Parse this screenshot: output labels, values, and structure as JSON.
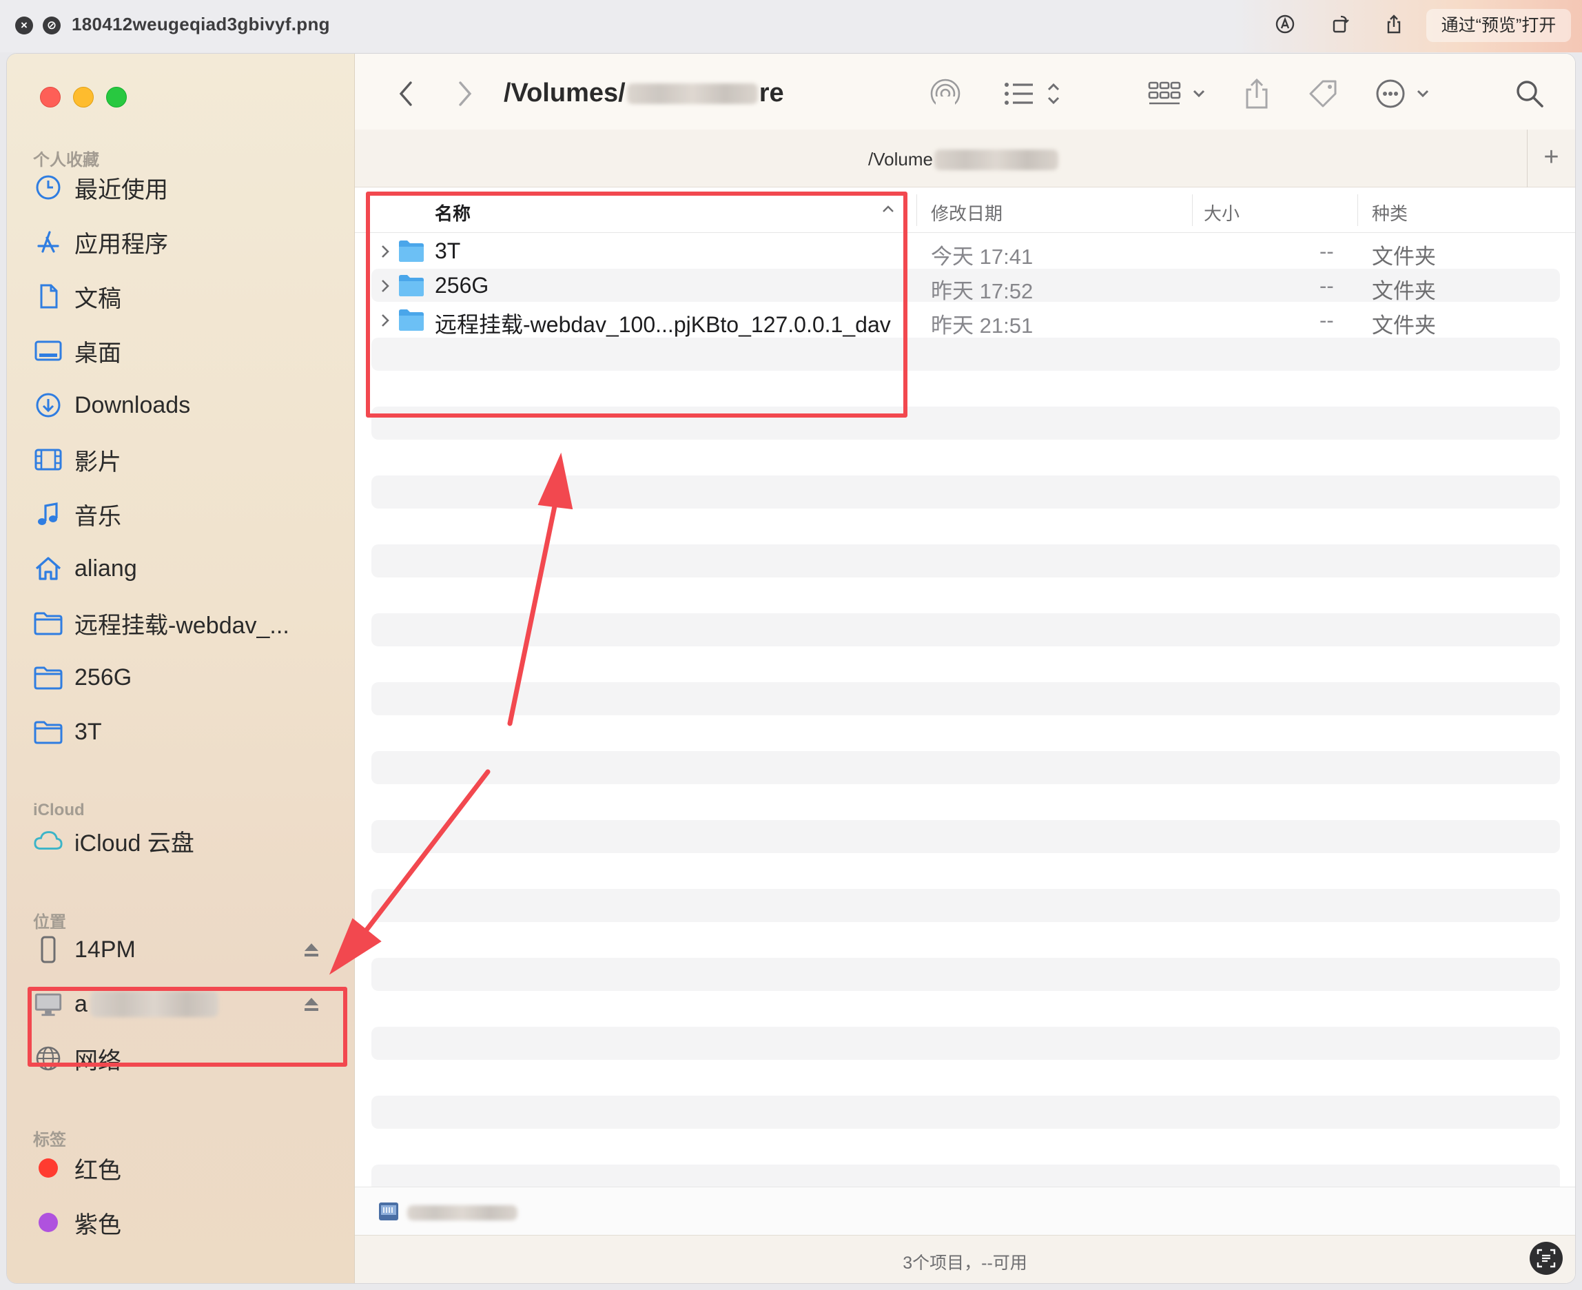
{
  "quicklook": {
    "filename": "180412weugeqiad3gbivyf.png",
    "open_with_label": "通过“预览”打开"
  },
  "sidebar": {
    "favorites_header": "个人收藏",
    "favorites": [
      {
        "label": "最近使用",
        "icon": "clock-icon"
      },
      {
        "label": "应用程序",
        "icon": "apps-icon"
      },
      {
        "label": "文稿",
        "icon": "document-icon"
      },
      {
        "label": "桌面",
        "icon": "desktop-icon"
      },
      {
        "label": "Downloads",
        "icon": "download-icon"
      },
      {
        "label": "影片",
        "icon": "film-icon"
      },
      {
        "label": "音乐",
        "icon": "music-icon"
      },
      {
        "label": "aliang",
        "icon": "home-icon"
      },
      {
        "label": "远程挂载-webdav_...",
        "icon": "folder-icon"
      },
      {
        "label": "256G",
        "icon": "folder-icon"
      },
      {
        "label": "3T",
        "icon": "folder-icon"
      }
    ],
    "icloud_header": "iCloud",
    "icloud": [
      {
        "label": "iCloud 云盘",
        "icon": "cloud-icon"
      }
    ],
    "locations_header": "位置",
    "locations": [
      {
        "label": "14PM",
        "icon": "phone-icon"
      },
      {
        "label": "a",
        "icon": "computer-icon"
      },
      {
        "label": "网络",
        "icon": "network-icon"
      }
    ],
    "tags_header": "标签",
    "tags": [
      {
        "label": "红色",
        "color": "#ff3b30"
      },
      {
        "label": "紫色",
        "color": "#af52de"
      }
    ]
  },
  "toolbar": {
    "path_prefix": "/Volumes/",
    "path_suffix": "re"
  },
  "tab": {
    "label_prefix": "/Volume"
  },
  "columns": {
    "name": "名称",
    "date": "修改日期",
    "size": "大小",
    "kind": "种类"
  },
  "files": [
    {
      "name": "3T",
      "date": "今天 17:41",
      "size": "--",
      "kind": "文件夹"
    },
    {
      "name": "256G",
      "date": "昨天 17:52",
      "size": "--",
      "kind": "文件夹"
    },
    {
      "name": "远程挂载-webdav_100...pjKBto_127.0.0.1_dav",
      "date": "昨天 21:51",
      "size": "--",
      "kind": "文件夹"
    }
  ],
  "status": {
    "text": "3个项目，--可用"
  },
  "colors": {
    "annotation": "#f2484f",
    "folder": "#5ab4f0",
    "accent": "#2f7de1"
  }
}
